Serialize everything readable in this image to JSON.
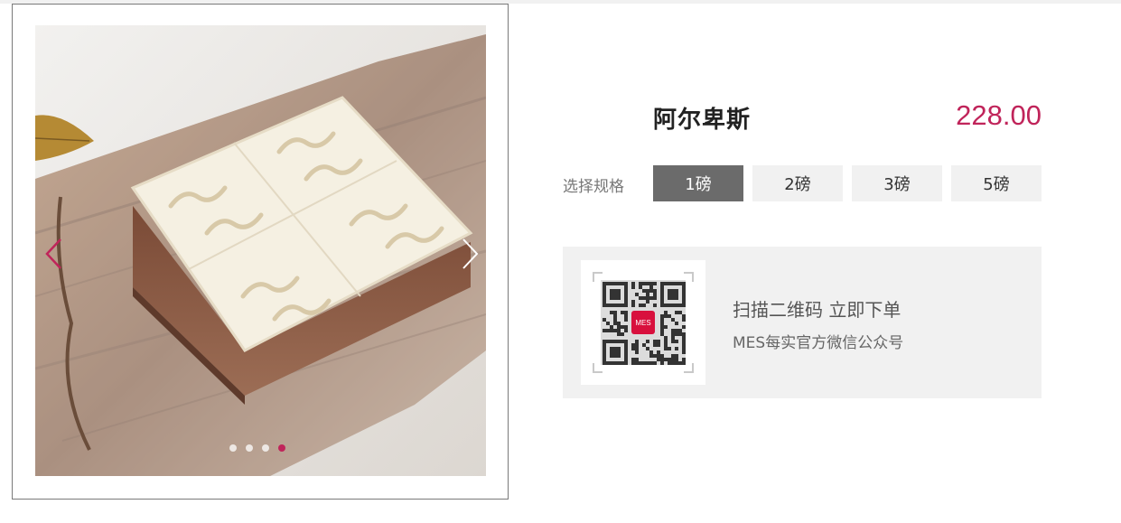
{
  "product": {
    "name": "阿尔卑斯",
    "price": "228.00",
    "accent_color": "#c0245a"
  },
  "spec": {
    "label": "选择规格",
    "options": [
      "1磅",
      "2磅",
      "3磅",
      "5磅"
    ],
    "selected": "1磅"
  },
  "gallery": {
    "slide_count": 4,
    "active_slide": 4,
    "prev_icon": "chevron-left-icon",
    "next_icon": "chevron-right-icon"
  },
  "qr": {
    "title": "扫描二维码 立即下单",
    "subtitle": "MES每实官方微信公众号",
    "logo_text": "MES"
  }
}
